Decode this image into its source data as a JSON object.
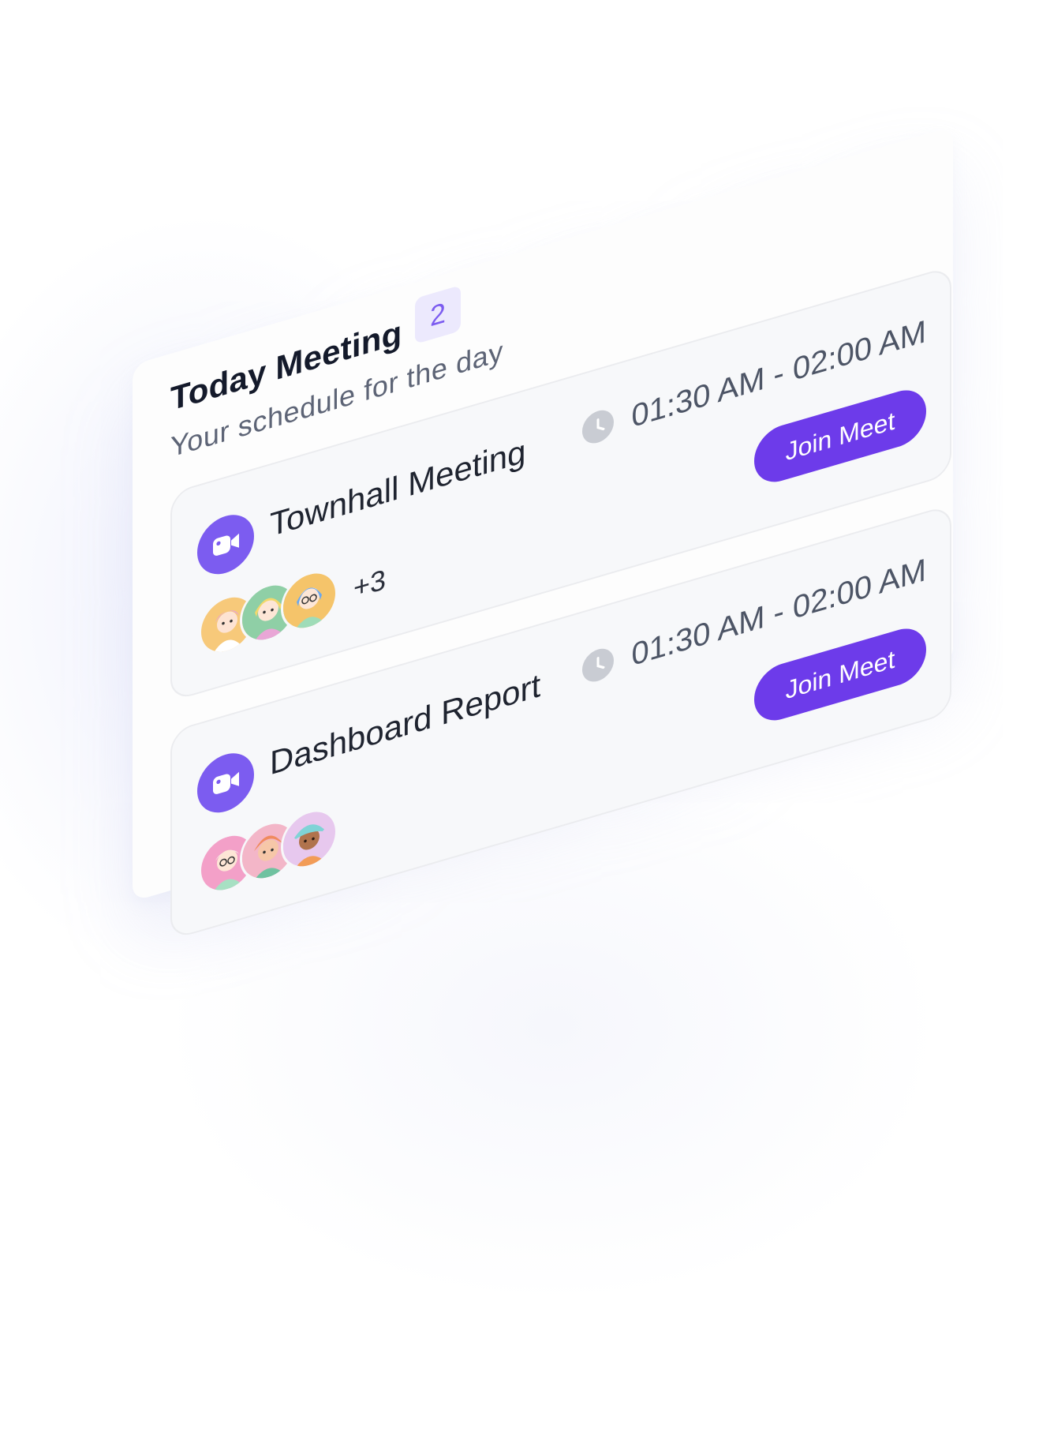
{
  "header": {
    "title": "Today Meeting",
    "count": "2",
    "subtitle": "Your schedule for the day"
  },
  "meetings": [
    {
      "name": "Townhall Meeting",
      "time": "01:30 AM - 02:00 AM",
      "join_label": "Join Meet",
      "extra_attendees": "+3",
      "icon": "video-camera-icon"
    },
    {
      "name": "Dashboard Report",
      "time": "01:30 AM - 02:00 AM",
      "join_label": "Join Meet",
      "extra_attendees": "",
      "icon": "video-camera-icon"
    }
  ],
  "colors": {
    "accent": "#6d3bea",
    "icon_purple": "#7c5cf0",
    "badge_bg": "#ece9fd",
    "title_text": "#141a2b"
  }
}
